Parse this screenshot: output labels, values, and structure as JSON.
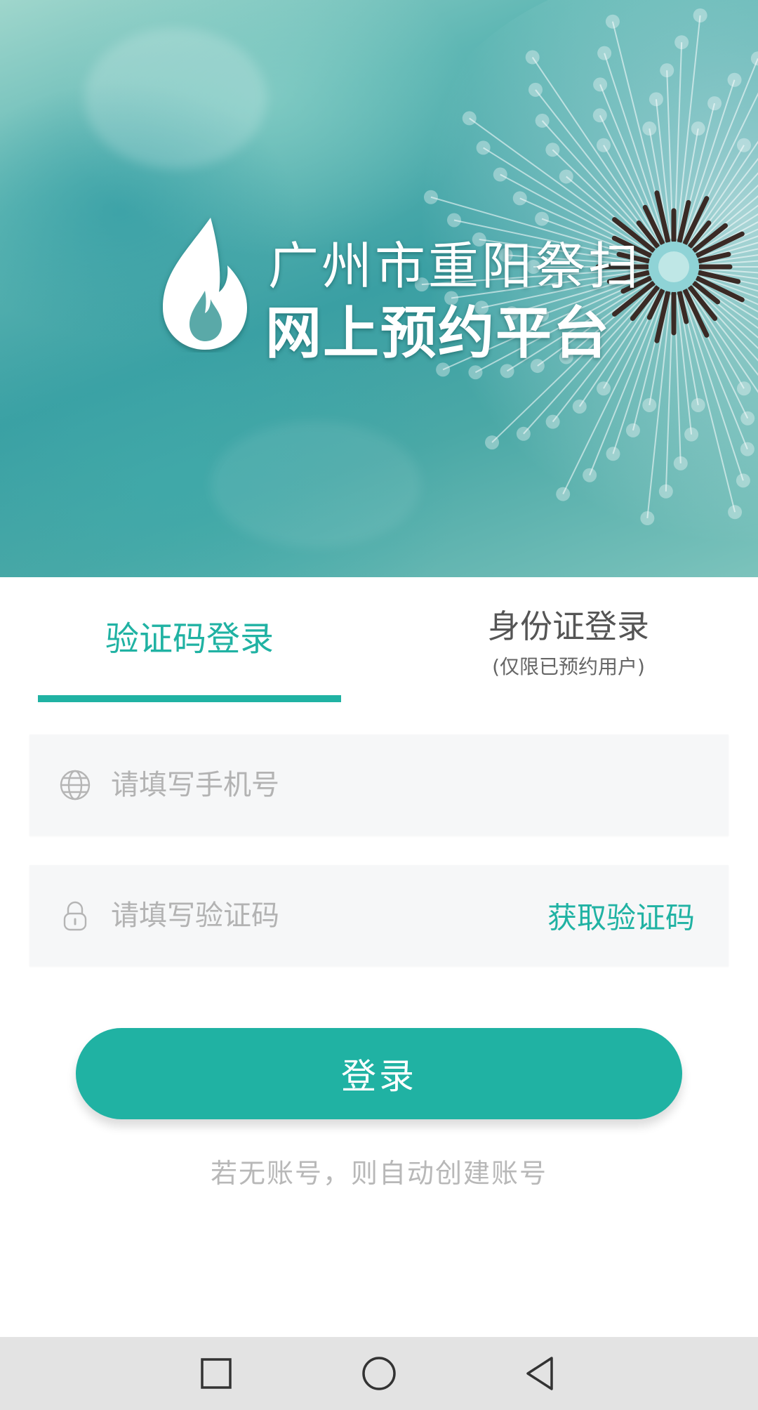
{
  "hero": {
    "title_line1": "广州市重阳祭扫",
    "title_line2": "网上预约平台",
    "logo_icon": "flame-icon"
  },
  "tabs": [
    {
      "label": "验证码登录",
      "active": true
    },
    {
      "label": "身份证登录",
      "sublabel": "(仅限已预约用户)",
      "active": false
    }
  ],
  "form": {
    "phone": {
      "placeholder": "请填写手机号",
      "value": "",
      "icon": "globe-icon"
    },
    "code": {
      "placeholder": "请填写验证码",
      "value": "",
      "icon": "lock-icon"
    },
    "get_code_label": "获取验证码"
  },
  "login_button_label": "登录",
  "hint": "若无账号，则自动创建账号",
  "colors": {
    "accent": "#20b2a3",
    "field_bg": "#f6f7f8",
    "navbar_bg": "#e3e3e3"
  },
  "navbar": {
    "items": [
      "recent-apps-icon",
      "home-icon",
      "back-icon"
    ]
  }
}
